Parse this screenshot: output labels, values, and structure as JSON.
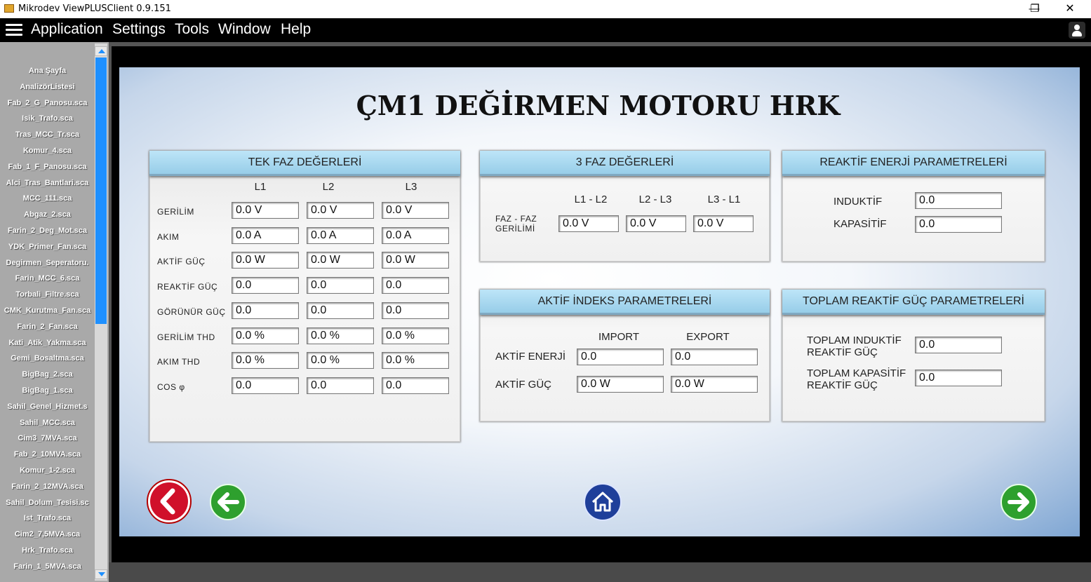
{
  "window": {
    "title": "Mikrodev ViewPLUSClient 0.9.151",
    "minimize": "—",
    "maximize": "❐",
    "close": "✕"
  },
  "menu": [
    "Application",
    "Settings",
    "Tools",
    "Window",
    "Help"
  ],
  "sidebar": {
    "items": [
      "Ana Şayfa",
      "AnalizörListesi",
      "Fab_2_G_Panosu.sca",
      "Isik_Trafo.sca",
      "Tras_MCC_Tr.sca",
      "Komur_4.sca",
      "Fab_1_F_Panosu.sca",
      "Alci_Tras_Bantlari.sca",
      "MCC_111.sca",
      "Abgaz_2.sca",
      "Farin_2_Deg_Mot.sca",
      "YDK_Primer_Fan.sca",
      "Degirmen_Seperatoru.",
      "Farin_MCC_6.sca",
      "Torbali_Filtre.sca",
      "CMK_Kurutma_Fan.sca",
      "Farin_2_Fan.sca",
      "Kati_Atik_Yakma.sca",
      "Gemi_Bosaltma.sca",
      "BigBag_2.sca",
      "BigBag_1.sca",
      "Sahil_Genel_Hizmet.s",
      "Sahil_MCC.sca",
      "Cim3_7MVA.sca",
      "Fab_2_10MVA.sca",
      "Komur_1-2.sca",
      "Farin_2_12MVA.sca",
      "Sahil_Dolum_Tesisi.sc",
      "Ist_Trafo.sca",
      "Cim2_7,5MVA.sca",
      "Hrk_Trafo.sca",
      "Farin_1_5MVA.sca"
    ]
  },
  "screen": {
    "title": "ÇM1 DEĞİRMEN MOTORU HRK",
    "tek_faz": {
      "header": "TEK FAZ DEĞERLERİ",
      "columns": [
        "L1",
        "L2",
        "L3"
      ],
      "rows": [
        {
          "label": "GERİLİM",
          "values": [
            "0.0 V",
            "0.0 V",
            "0.0 V"
          ]
        },
        {
          "label": "AKIM",
          "values": [
            "0.0 A",
            "0.0 A",
            "0.0 A"
          ]
        },
        {
          "label": "AKTİF GÜÇ",
          "values": [
            "0.0 W",
            "0.0 W",
            "0.0 W"
          ]
        },
        {
          "label": "REAKTİF GÜÇ",
          "values": [
            "0.0",
            "0.0",
            "0.0"
          ]
        },
        {
          "label": "GÖRÜNÜR GÜÇ",
          "values": [
            "0.0",
            "0.0",
            "0.0"
          ]
        },
        {
          "label": "GERİLİM THD",
          "values": [
            "0.0 %",
            "0.0 %",
            "0.0 %"
          ]
        },
        {
          "label": "AKIM THD",
          "values": [
            "0.0 %",
            "0.0 %",
            "0.0 %"
          ]
        },
        {
          "label": "COS φ",
          "values": [
            "0.0",
            "0.0",
            "0.0"
          ]
        }
      ]
    },
    "uc_faz": {
      "header": "3 FAZ DEĞERLERİ",
      "columns": [
        "L1 - L2",
        "L2 - L3",
        "L3 - L1"
      ],
      "row_label_1": "FAZ - FAZ",
      "row_label_2": "GERİLİMİ",
      "values": [
        "0.0 V",
        "0.0 V",
        "0.0 V"
      ]
    },
    "reaktif_enerji": {
      "header": "REAKTİF ENERJİ PARAMETRELERİ",
      "rows": [
        {
          "label": "INDUKTİF",
          "value": "0.0"
        },
        {
          "label": "KAPASİTİF",
          "value": "0.0"
        }
      ]
    },
    "aktif_indeks": {
      "header": "AKTİF İNDEKS PARAMETRELERİ",
      "columns": [
        "IMPORT",
        "EXPORT"
      ],
      "rows": [
        {
          "label": "AKTİF ENERJİ",
          "values": [
            "0.0",
            "0.0"
          ]
        },
        {
          "label": "AKTİF GÜÇ",
          "values": [
            "0.0 W",
            "0.0 W"
          ]
        }
      ]
    },
    "toplam_reaktif": {
      "header": "TOPLAM REAKTİF GÜÇ PARAMETRELERİ",
      "rows": [
        {
          "label_1": "TOPLAM INDUKTİF",
          "label_2": "REAKTİF GÜÇ",
          "value": "0.0"
        },
        {
          "label_1": "TOPLAM KAPASİTİF",
          "label_2": "REAKTİF GÜÇ",
          "value": "0.0"
        }
      ]
    }
  },
  "colors": {
    "panel_header": "#a8d8ef",
    "back_button": "#c8102e",
    "nav_green": "#2e9e2e",
    "home_button": "#1f3f9a"
  }
}
